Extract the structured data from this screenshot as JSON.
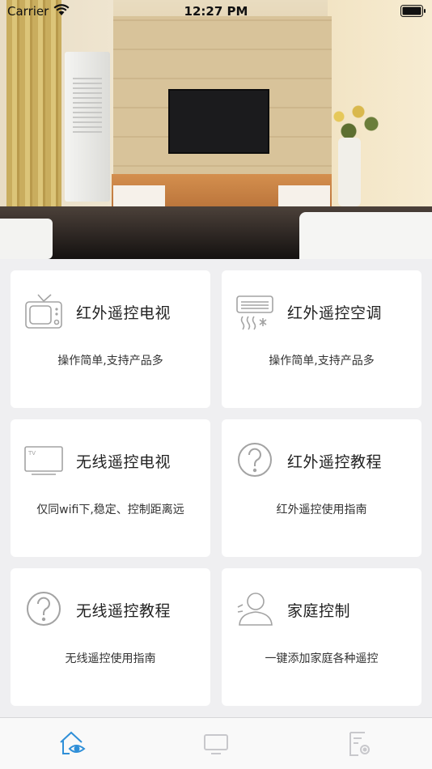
{
  "status_bar": {
    "carrier": "Carrier",
    "time": "12:27 PM"
  },
  "hero": {
    "icon": "living-room-photo"
  },
  "cards": [
    {
      "title": "红外遥控电视",
      "subtitle": "操作简单,支持产品多",
      "icon": "retro-tv-icon"
    },
    {
      "title": "红外遥控空调",
      "subtitle": "操作简单,支持产品多",
      "icon": "air-conditioner-icon"
    },
    {
      "title": "无线遥控电视",
      "subtitle": "仅同wifi下,稳定、控制距离远",
      "icon": "flat-tv-icon"
    },
    {
      "title": "红外遥控教程",
      "subtitle": "红外遥控使用指南",
      "icon": "question-icon"
    },
    {
      "title": "无线遥控教程",
      "subtitle": "无线遥控使用指南",
      "icon": "question-icon"
    },
    {
      "title": "家庭控制",
      "subtitle": "一键添加家庭各种遥控",
      "icon": "user-icon"
    }
  ],
  "tabbar": {
    "tabs": [
      {
        "icon": "home-eye-icon",
        "active": true
      },
      {
        "icon": "monitor-icon",
        "active": false
      },
      {
        "icon": "settings-doc-icon",
        "active": false
      }
    ],
    "active_color": "#2f8fd8",
    "inactive_color": "#c8c8cc"
  },
  "colors": {
    "background": "#efeff1",
    "card": "#ffffff",
    "icon_gray": "#9a9a9a"
  }
}
